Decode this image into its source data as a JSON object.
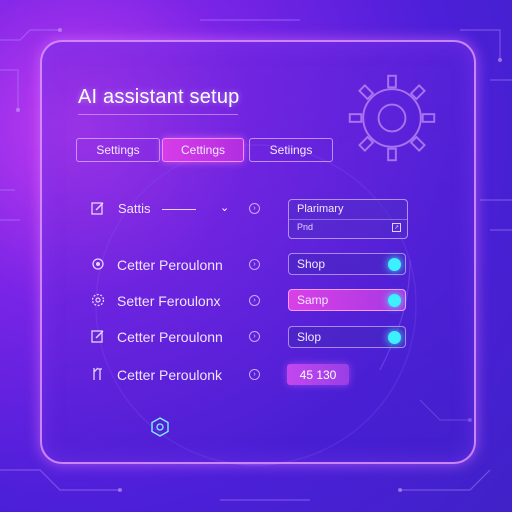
{
  "window": {
    "title": "AI assistant setup"
  },
  "tabs": [
    {
      "label": "Settings"
    },
    {
      "label": "Cettings"
    },
    {
      "label": "Setiings"
    }
  ],
  "rows": [
    {
      "label": "Sattis",
      "icon": "edit-icon"
    },
    {
      "label": "Cetter Peroulonn",
      "icon": "gear-icon"
    },
    {
      "label": "Setter Feroulonx",
      "icon": "settings-icon"
    },
    {
      "label": "Cetter Peroulonn",
      "icon": "edit-icon"
    },
    {
      "label": "Cetter Peroulonk",
      "icon": "tools-icon"
    }
  ],
  "dropdown": {
    "line1": "Plarimary",
    "line2": "Pnd"
  },
  "fields": [
    {
      "label": "Shop",
      "toggle": "on"
    },
    {
      "label": "Samp",
      "toggle": "on"
    },
    {
      "label": "Slop",
      "toggle": "on"
    }
  ],
  "value_box": "45 130",
  "colors": {
    "accent": "#d83ce8",
    "toggle": "#3df0ff",
    "background": "#4c1fd8"
  }
}
